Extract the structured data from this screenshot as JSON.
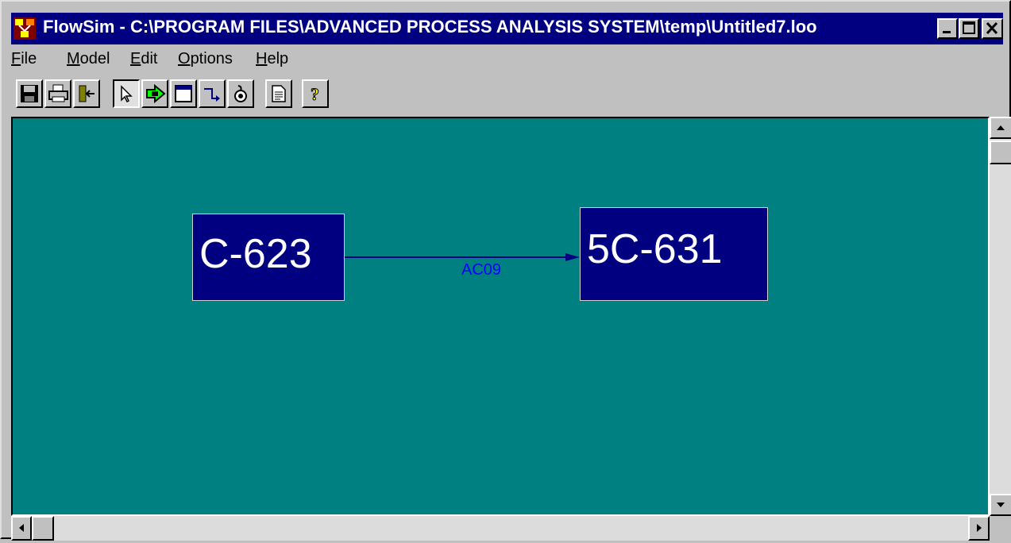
{
  "window": {
    "title": "FlowSim - C:\\PROGRAM FILES\\ADVANCED PROCESS ANALYSIS SYSTEM\\temp\\Untitled7.loo"
  },
  "menu": {
    "items": [
      {
        "label": "File",
        "accel": "F",
        "rest": "ile"
      },
      {
        "label": "Model",
        "accel": "M",
        "rest": "odel"
      },
      {
        "label": "Edit",
        "accel": "E",
        "rest": "dit"
      },
      {
        "label": "Options",
        "accel": "O",
        "rest": "ptions"
      },
      {
        "label": "Help",
        "accel": "H",
        "rest": "elp"
      }
    ]
  },
  "toolbar": {
    "buttons": [
      {
        "icon": "save-icon",
        "pressed": false
      },
      {
        "icon": "print-icon",
        "pressed": false
      },
      {
        "icon": "exit-icon",
        "pressed": false
      },
      {
        "icon": "pointer-icon",
        "pressed": true
      },
      {
        "icon": "add-node-icon",
        "pressed": false
      },
      {
        "icon": "window-icon",
        "pressed": false
      },
      {
        "icon": "connector-icon",
        "pressed": false
      },
      {
        "icon": "bomb-icon",
        "pressed": false
      },
      {
        "icon": "document-icon",
        "pressed": false
      },
      {
        "icon": "help-icon",
        "pressed": false
      }
    ]
  },
  "diagram": {
    "nodes": [
      {
        "id": "C-623",
        "label": "C-623"
      },
      {
        "id": "5C-631",
        "label": "5C-631"
      }
    ],
    "edges": [
      {
        "from": "C-623",
        "to": "5C-631",
        "label": "AC09"
      }
    ]
  },
  "colors": {
    "canvas": "#008080",
    "node": "#000080",
    "edge": "#000080",
    "edge_label": "#0000ff",
    "titlebar": "#000080"
  }
}
